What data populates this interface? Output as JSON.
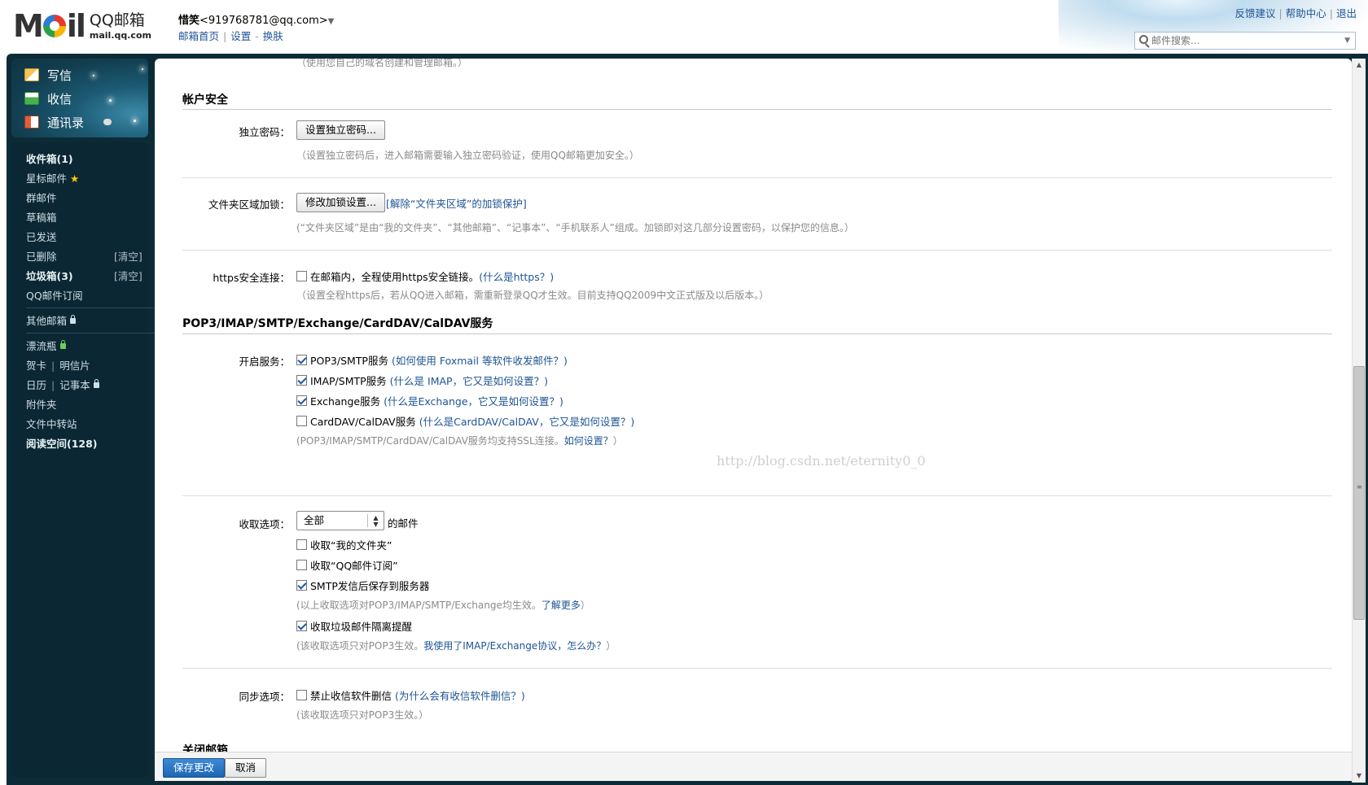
{
  "header": {
    "logo_text": "MOil",
    "brand_cn": "QQ邮箱",
    "brand_domain": "mail.qq.com",
    "user_nick": "惜笑",
    "user_email": "<919768781@qq.com>",
    "links": [
      "邮箱首页",
      "设置",
      "换肤"
    ],
    "right_links": [
      "反馈建议",
      "帮助中心",
      "退出"
    ],
    "search_placeholder": "邮件搜索..."
  },
  "sidebar": {
    "quick_actions": [
      "写信",
      "收信",
      "通讯录"
    ],
    "folders": {
      "inbox": "收件箱(1)",
      "starred": "星标邮件",
      "group": "群邮件",
      "drafts": "草稿箱",
      "sent": "已发送",
      "deleted": "已删除",
      "junk": "垃圾箱(3)",
      "subscription": "QQ邮件订阅",
      "other_mailboxes": "其他邮箱",
      "drift_bottle": "漂流瓶",
      "greeting_card": "贺卡",
      "postcard": "明信片",
      "calendar": "日历",
      "notebook": "记事本",
      "attachments": "附件夹",
      "file_transfer": "文件中转站",
      "reading_space": "阅读空间(128)",
      "clear_label": "[清空]"
    }
  },
  "content": {
    "top_clipped_hint": "（使用您自己的域名创建和管理邮箱。）",
    "account_security": {
      "title": "帐户安全",
      "independent_password": {
        "label": "独立密码：",
        "button": "设置独立密码...",
        "hint": "（设置独立密码后，进入邮箱需要输入独立密码验证，使用QQ邮箱更加安全。）"
      },
      "folder_lock": {
        "label": "文件夹区域加锁：",
        "button": "修改加锁设置...",
        "link": "[解除“文件夹区域”的加锁保护]",
        "hint": "(“文件夹区域”是由“我的文件夹”、“其他邮箱”、“记事本”、“手机联系人”组成。加锁即对这几部分设置密码，以保护您的信息。）"
      },
      "https": {
        "label": "https安全连接：",
        "checkbox_label": "在邮箱内，全程使用https安全链接。",
        "link": "(什么是https？)",
        "hint": "（设置全程https后，若从QQ进入邮箱，需重新登录QQ才生效。目前支持QQ2009中文正式版及以后版本。）"
      }
    },
    "services": {
      "title": "POP3/IMAP/SMTP/Exchange/CardDAV/CalDAV服务",
      "enable_label": "开启服务：",
      "items": [
        {
          "label": "POP3/SMTP服务",
          "help": "(如何使用 Foxmail 等软件收发邮件？)",
          "checked": true
        },
        {
          "label": "IMAP/SMTP服务",
          "help": "(什么是 IMAP，它又是如何设置？)",
          "checked": true
        },
        {
          "label": "Exchange服务",
          "help": "(什么是Exchange，它又是如何设置？)",
          "checked": true
        },
        {
          "label": "CardDAV/CalDAV服务",
          "help": "(什么是CardDAV/CalDAV，它又是如何设置？)",
          "checked": false
        }
      ],
      "ssl_hint": "(POP3/IMAP/SMTP/CardDAV/CalDAV服务均支持SSL连接。",
      "ssl_link": "如何设置？",
      "ssl_hint_end": "）",
      "watermark": "http://blog.csdn.net/eternity0_0"
    },
    "fetch_options": {
      "label": "收取选项：",
      "select_value": "全部",
      "select_suffix": "的邮件",
      "options": [
        {
          "label": "收取“我的文件夹”",
          "checked": false
        },
        {
          "label": "收取“QQ邮件订阅”",
          "checked": false
        },
        {
          "label": "SMTP发信后保存到服务器",
          "checked": true
        }
      ],
      "hint1": "(以上收取选项对POP3/IMAP/SMTP/Exchange均生效。",
      "hint1_link": "了解更多",
      "hint1_end": "）",
      "junk_option": {
        "label": "收取垃圾邮件隔离提醒",
        "checked": true
      },
      "hint2": "(该收取选项只对POP3生效。",
      "hint2_link": "我使用了IMAP/Exchange协议，怎么办？",
      "hint2_end": "）"
    },
    "sync_options": {
      "label": "同步选项：",
      "checkbox_label": "禁止收信软件删信",
      "link": "(为什么会有收信软件删信？)",
      "checked": false,
      "hint": "(该收取选项只对POP3生效。）"
    },
    "close_mailbox": {
      "title": "关闭邮箱"
    }
  },
  "bottom": {
    "save": "保存更改",
    "cancel": "取消"
  }
}
